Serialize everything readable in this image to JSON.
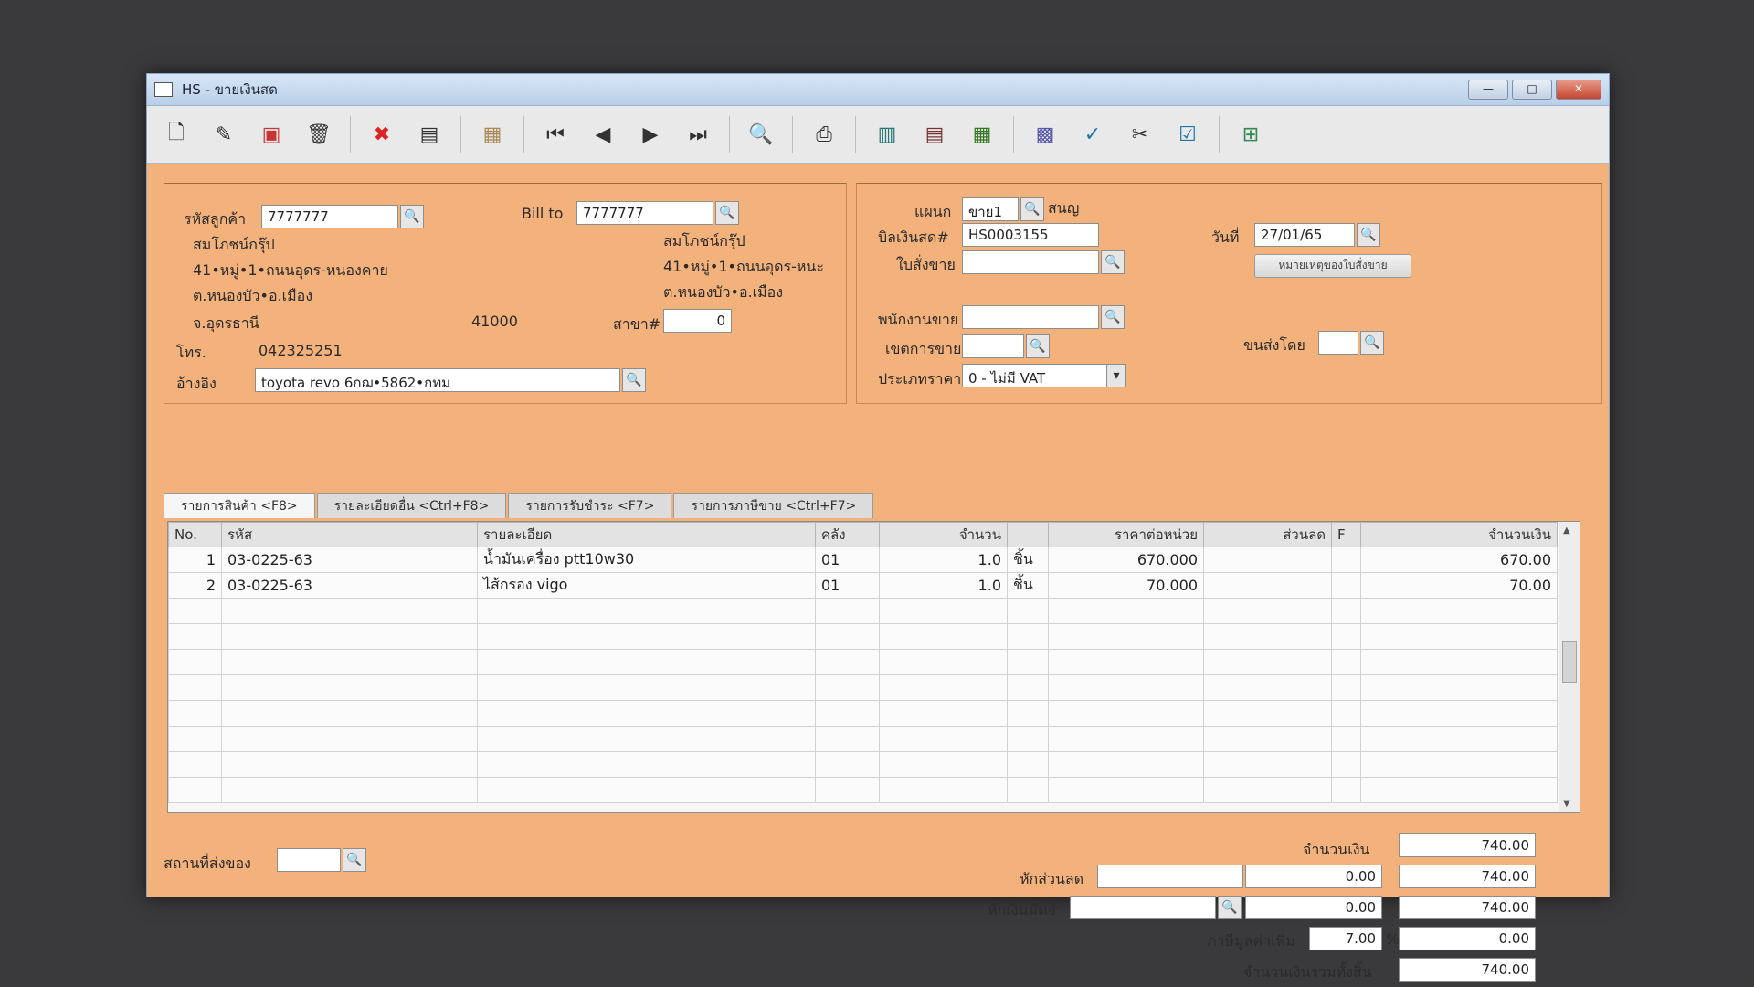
{
  "window": {
    "title": "HS - ขายเงินสด",
    "minimize": "—",
    "maximize": "□",
    "close": "✕"
  },
  "customer": {
    "code_label": "รหัสลูกค้า",
    "code": "7777777",
    "name": "สมโภชน์กรุ๊ป",
    "address1": "41•หมู่•1•ถนนอุดร-หนองคาย",
    "address2": "ต.หนองบัว•อ.เมือง",
    "province": "จ.อุดรธานี",
    "postcode": "41000",
    "phone_label": "โทร.",
    "phone": "042325251",
    "ref_label": "อ้างอิง",
    "ref": "toyota revo 6กฌ•5862•กทม"
  },
  "billto": {
    "label": "Bill to",
    "code": "7777777",
    "name": "สมโภชน์กรุ๊ป",
    "address1": "41•หมู่•1•ถนนอุดร-หนะ",
    "address2": "ต.หนองบัว•อ.เมือง",
    "branch_label": "สาขา#",
    "branch": "0"
  },
  "sale": {
    "dept_label": "แผนก",
    "dept_code": "ขาย1",
    "dept_name": "สนญ",
    "bill_label": "บิลเงินสด#",
    "bill_no": "HS0003155",
    "order_label": "ใบสั่งขาย",
    "order_no": "",
    "date_label": "วันที่",
    "date": "27/01/65",
    "note_button": "หมายเหตุของใบสั่งขาย",
    "salesman_label": "พนักงานขาย",
    "salesman": "",
    "area_label": "เขตการขาย",
    "area": "",
    "ship_by_label": "ขนส่งโดย",
    "ship_by": "",
    "price_type_label": "ประเภทราคา",
    "price_type": "0 - ไม่มี VAT"
  },
  "tabs": [
    "รายการสินค้า <F8>",
    "รายละเอียดอื่น <Ctrl+F8>",
    "รายการรับชำระ <F7>",
    "รายการภาษีขาย <Ctrl+F7>"
  ],
  "grid": {
    "headers": [
      "No.",
      "รหัส",
      "รายละเอียด",
      "คลัง",
      "จำนวน",
      "",
      "ราคาต่อหน่วย",
      "ส่วนลด",
      "F",
      "จำนวนเงิน"
    ],
    "rows": [
      {
        "no": "1",
        "code": "03-0225-63",
        "desc": "น้ำมันเครื่อง ptt10w30",
        "wh": "01",
        "qty": "1.0",
        "unit": "ชิ้น",
        "price": "670.000",
        "disc": "",
        "f": "",
        "amount": "670.00"
      },
      {
        "no": "2",
        "code": "03-0225-63",
        "desc": "ไส้กรอง vigo",
        "wh": "01",
        "qty": "1.0",
        "unit": "ชิ้น",
        "price": "70.000",
        "disc": "",
        "f": "",
        "amount": "70.00"
      }
    ]
  },
  "footer": {
    "delivery_label": "สถานที่ส่งของ",
    "delivery": "",
    "amount_label": "จำนวนเงิน",
    "amount": "740.00",
    "discount_label": "หักส่วนลด",
    "discount_text": "",
    "discount_value": "0.00",
    "after_discount": "740.00",
    "deposit_label": "หักเงินมัดจำ",
    "deposit_text": "",
    "deposit_value": "0.00",
    "after_deposit": "740.00",
    "vat_label": "ภาษีมูลค่าเพิ่ม",
    "vat_rate": "7.00",
    "vat_unit": "%",
    "vat_amount": "0.00",
    "total_label": "จำนวนเงินรวมทั้งสิ้น",
    "total": "740.00"
  },
  "icons": [
    "new-document-icon",
    "edit-icon",
    "void-icon",
    "trash-icon",
    "cancel-icon",
    "save-icon",
    "stack-icon",
    "first-record-icon",
    "previous-record-icon",
    "next-record-icon",
    "last-record-icon",
    "find-icon",
    "print-icon",
    "form-icon",
    "report-icon",
    "calculator-icon",
    "grid-icon",
    "approve-icon",
    "scissors-icon",
    "ok-icon",
    "network-icon"
  ]
}
